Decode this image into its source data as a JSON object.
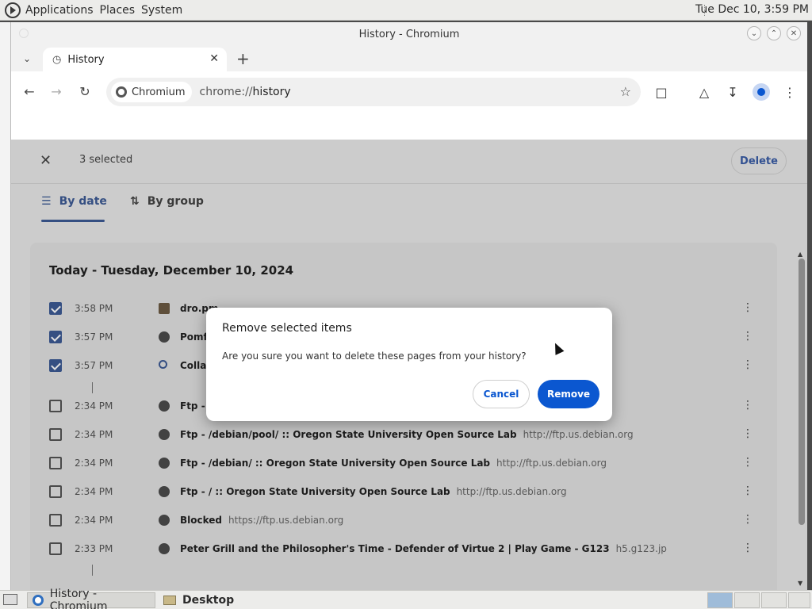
{
  "top_panel": {
    "menu": [
      "Applications",
      "Places",
      "System"
    ],
    "clock": "Tue Dec 10,  3:59 PM"
  },
  "window": {
    "title": "History - Chromium"
  },
  "tab": {
    "label": "History"
  },
  "omnibox": {
    "chip": "Chromium",
    "url_scheme": "chrome://",
    "url_path": "history"
  },
  "selection_bar": {
    "count": "3 selected",
    "delete_label": "Delete"
  },
  "view_tabs": {
    "by_date": "By date",
    "by_group": "By group"
  },
  "history": {
    "heading": "Today - Tuesday, December 10, 2024",
    "rows": [
      {
        "checked": true,
        "time": "3:58 PM",
        "title": "dro.pm",
        "domain": ""
      },
      {
        "checked": true,
        "time": "3:57 PM",
        "title": "Pomf",
        "domain": ""
      },
      {
        "checked": true,
        "time": "3:57 PM",
        "title": "Collab",
        "domain": ""
      },
      {
        "checked": false,
        "time": "2:34 PM",
        "title": "Ftp - /",
        "domain": ""
      },
      {
        "checked": false,
        "time": "2:34 PM",
        "title": "Ftp - /debian/pool/ :: Oregon State University Open Source Lab",
        "domain": "http://ftp.us.debian.org"
      },
      {
        "checked": false,
        "time": "2:34 PM",
        "title": "Ftp - /debian/ :: Oregon State University Open Source Lab",
        "domain": "http://ftp.us.debian.org"
      },
      {
        "checked": false,
        "time": "2:34 PM",
        "title": "Ftp - / :: Oregon State University Open Source Lab",
        "domain": "http://ftp.us.debian.org"
      },
      {
        "checked": false,
        "time": "2:34 PM",
        "title": "Blocked",
        "domain": "https://ftp.us.debian.org"
      },
      {
        "checked": false,
        "time": "2:33 PM",
        "title": "Peter Grill and the Philosopher's Time - Defender of Virtue 2 | Play Game - G123",
        "domain": "h5.g123.jp"
      }
    ]
  },
  "dialog": {
    "title": "Remove selected items",
    "message": "Are you sure you want to delete these pages from your history?",
    "cancel_label": "Cancel",
    "remove_label": "Remove"
  },
  "taskbar": {
    "items": [
      "History - Chromium",
      "Desktop"
    ]
  },
  "colors": {
    "accent": "#0b57d0",
    "dimmed_accent": "#3d5a94"
  }
}
